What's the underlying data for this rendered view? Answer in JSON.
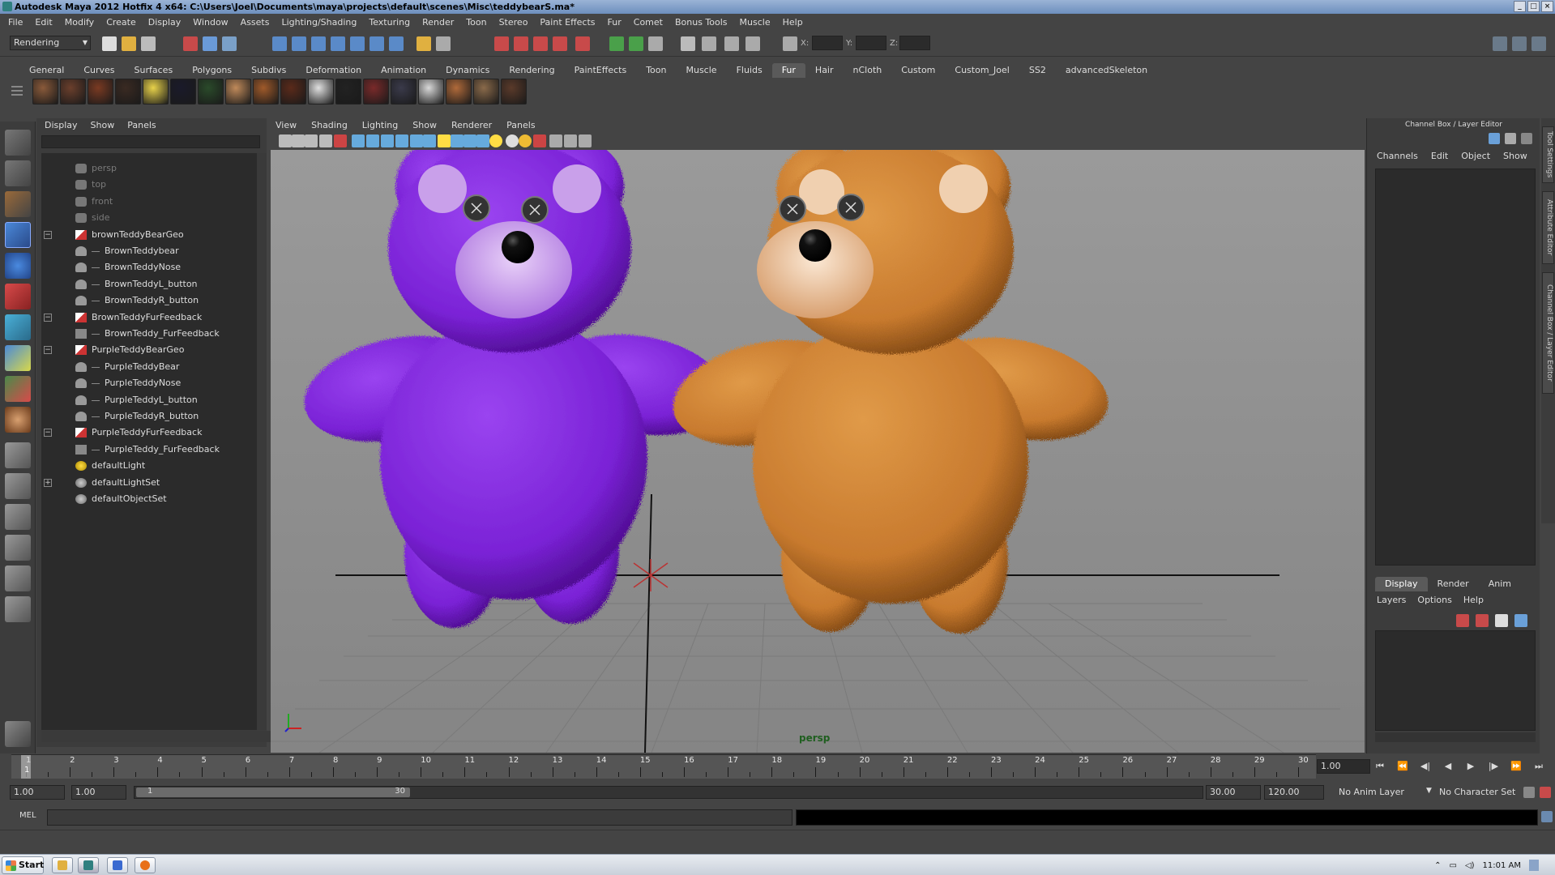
{
  "window": {
    "title": "Autodesk Maya 2012 Hotfix 4 x64: C:\\Users\\Joel\\Documents\\maya\\projects\\default\\scenes\\Misc\\teddybearS.ma*"
  },
  "menu": [
    "File",
    "Edit",
    "Modify",
    "Create",
    "Display",
    "Window",
    "Assets",
    "Lighting/Shading",
    "Texturing",
    "Render",
    "Toon",
    "Stereo",
    "Paint Effects",
    "Fur",
    "Comet",
    "Bonus Tools",
    "Muscle",
    "Help"
  ],
  "status": {
    "menu_set": "Rendering",
    "x_label": "X:",
    "y_label": "Y:",
    "z_label": "Z:"
  },
  "shelf": {
    "tabs": [
      "General",
      "Curves",
      "Surfaces",
      "Polygons",
      "Subdivs",
      "Deformation",
      "Animation",
      "Dynamics",
      "Rendering",
      "PaintEffects",
      "Toon",
      "Muscle",
      "Fluids",
      "Fur",
      "Hair",
      "nCloth",
      "Custom",
      "Custom_Joel",
      "SS2",
      "advancedSkeleton"
    ],
    "active_tab": "Fur",
    "icon_colors": [
      "#8a5a3a",
      "#6b3f2c",
      "#7a3a22",
      "#3a2a22",
      "#e8d24a",
      "#1a1a2a",
      "#2a4a2a",
      "#c08a5a",
      "#a05a2a",
      "#5a2a1a",
      "#e0e0e0",
      "#222222",
      "#7a2a2a",
      "#3a3a4a",
      "#d8d8d8",
      "#b06a3a",
      "#8a6a4a",
      "#5a3a2a"
    ]
  },
  "outliner": {
    "menu": [
      "Display",
      "Show",
      "Panels"
    ],
    "items": [
      {
        "label": "persp",
        "dim": true,
        "indent": 1,
        "icon": "camera-icon"
      },
      {
        "label": "top",
        "dim": true,
        "indent": 1,
        "icon": "camera-icon"
      },
      {
        "label": "front",
        "dim": true,
        "indent": 1,
        "icon": "camera-icon"
      },
      {
        "label": "side",
        "dim": true,
        "indent": 1,
        "icon": "camera-icon"
      },
      {
        "label": "brownTeddyBearGeo",
        "dim": false,
        "indent": 1,
        "icon": "group-icon",
        "expander": "−"
      },
      {
        "label": "BrownTeddybear",
        "dim": false,
        "indent": 2,
        "icon": "mesh-icon"
      },
      {
        "label": "BrownTeddyNose",
        "dim": false,
        "indent": 2,
        "icon": "mesh-icon"
      },
      {
        "label": "BrownTeddyL_button",
        "dim": false,
        "indent": 2,
        "icon": "mesh-icon"
      },
      {
        "label": "BrownTeddyR_button",
        "dim": false,
        "indent": 2,
        "icon": "mesh-icon"
      },
      {
        "label": "BrownTeddyFurFeedback",
        "dim": false,
        "indent": 1,
        "icon": "group-icon",
        "expander": "−"
      },
      {
        "label": "BrownTeddy_FurFeedback",
        "dim": false,
        "indent": 2,
        "icon": "fur-icon"
      },
      {
        "label": "PurpleTeddyBearGeo",
        "dim": false,
        "indent": 1,
        "icon": "group-icon",
        "expander": "−"
      },
      {
        "label": "PurpleTeddyBear",
        "dim": false,
        "indent": 2,
        "icon": "mesh-icon"
      },
      {
        "label": "PurpleTeddyNose",
        "dim": false,
        "indent": 2,
        "icon": "mesh-icon"
      },
      {
        "label": "PurpleTeddyL_button",
        "dim": false,
        "indent": 2,
        "icon": "mesh-icon"
      },
      {
        "label": "PurpleTeddyR_button",
        "dim": false,
        "indent": 2,
        "icon": "mesh-icon"
      },
      {
        "label": "PurpleTeddyFurFeedback",
        "dim": false,
        "indent": 1,
        "icon": "group-icon",
        "expander": "−"
      },
      {
        "label": "PurpleTeddy_FurFeedback",
        "dim": false,
        "indent": 2,
        "icon": "fur-icon"
      },
      {
        "label": "defaultLight",
        "dim": false,
        "indent": 1,
        "icon": "light-icon"
      },
      {
        "label": "defaultLightSet",
        "dim": false,
        "indent": 1,
        "icon": "set-icon",
        "expander": "+"
      },
      {
        "label": "defaultObjectSet",
        "dim": false,
        "indent": 1,
        "icon": "set-icon"
      }
    ]
  },
  "viewport": {
    "menu": [
      "View",
      "Shading",
      "Lighting",
      "Show",
      "Renderer",
      "Panels"
    ],
    "camera_label": "persp",
    "bear_colors": {
      "purple": "#7a22d6",
      "purple_light": "#c9a0ea",
      "brown": "#c87a2e",
      "brown_light": "#f0d0b0"
    }
  },
  "channel_box": {
    "title": "Channel Box / Layer Editor",
    "menu": [
      "Channels",
      "Edit",
      "Object",
      "Show"
    ],
    "layer_tabs": [
      "Display",
      "Render",
      "Anim"
    ],
    "layer_menu": [
      "Layers",
      "Options",
      "Help"
    ],
    "side_tabs": [
      "Tool Settings",
      "Attribute Editor",
      "Channel Box / Layer Editor"
    ]
  },
  "timeline": {
    "ticks": [
      "1",
      "2",
      "3",
      "4",
      "5",
      "6",
      "7",
      "8",
      "9",
      "10",
      "11",
      "12",
      "13",
      "14",
      "15",
      "16",
      "17",
      "18",
      "19",
      "20",
      "21",
      "22",
      "23",
      "24",
      "25",
      "26",
      "27",
      "28",
      "29",
      "30"
    ],
    "current_frame": "1",
    "current_time": "1.00"
  },
  "range": {
    "start_time": "1.00",
    "playback_start": "1.00",
    "handle_start": "1",
    "handle_end": "30",
    "playback_end": "30.00",
    "end_time": "120.00",
    "anim_layer": "No Anim Layer",
    "character_set": "No Character Set"
  },
  "command": {
    "label": "MEL"
  },
  "taskbar": {
    "start": "Start",
    "clock": "11:01 AM"
  }
}
